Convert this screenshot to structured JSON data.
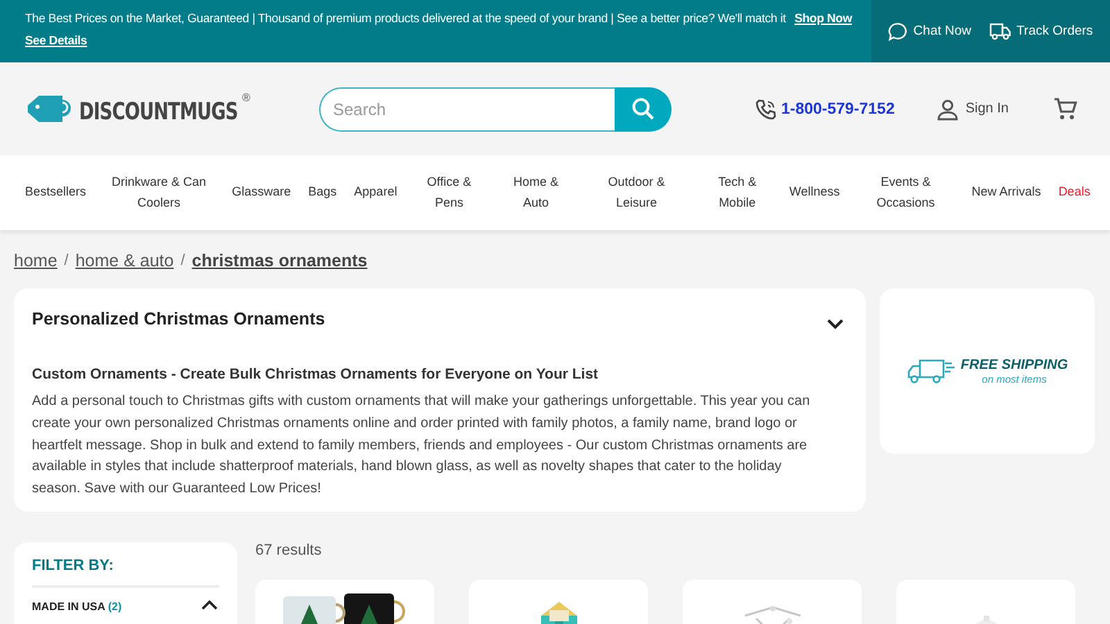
{
  "promo_bar": {
    "message": "The Best Prices on the Market, Guaranteed | Thousand of premium products delivered at the speed of your brand | See a better price? We'll match it",
    "links": [
      "Shop Now",
      "See Details"
    ],
    "actions": [
      {
        "kind": "chat",
        "label": "Chat Now"
      },
      {
        "kind": "track",
        "label": "Track Orders"
      }
    ]
  },
  "header": {
    "logo": {
      "name": "DISCOUNTMUGS",
      "mark": "®"
    },
    "search": {
      "placeholder": "Search"
    },
    "phone": "1-800-579-7152",
    "sign_in": "Sign In"
  },
  "nav": [
    {
      "label": "Bestsellers",
      "highlight": false
    },
    {
      "label": "Drinkware & Can Coolers",
      "highlight": false
    },
    {
      "label": "Glassware",
      "highlight": false
    },
    {
      "label": "Bags",
      "highlight": false
    },
    {
      "label": "Apparel",
      "highlight": false
    },
    {
      "label": "Office & Pens",
      "highlight": false
    },
    {
      "label": "Home & Auto",
      "highlight": false
    },
    {
      "label": "Outdoor & Leisure",
      "highlight": false
    },
    {
      "label": "Tech & Mobile",
      "highlight": false
    },
    {
      "label": "Wellness",
      "highlight": false
    },
    {
      "label": "Events & Occasions",
      "highlight": false
    },
    {
      "label": "New Arrivals",
      "highlight": false
    },
    {
      "label": "Deals",
      "highlight": true
    }
  ],
  "breadcrumb": {
    "items": [
      {
        "label": "home",
        "current": false
      },
      {
        "label": "home & auto",
        "current": false
      },
      {
        "label": "christmas ornaments",
        "current": true
      }
    ],
    "separators": [
      "/",
      "/"
    ]
  },
  "category": {
    "title": "Personalized Christmas Ornaments",
    "expanded": true,
    "subtitle": "Custom Ornaments - Create Bulk Christmas Ornaments for Everyone on Your List",
    "description": "Add a personal touch to Christmas gifts with custom ornaments that will make your gatherings unforgettable. This year you can create your own personalized Christmas ornaments online and order printed with family photos, a family name, brand logo or heartfelt message. Shop in bulk and extend to family members, friends and employees - Our custom Christmas ornaments are available in styles that include shatterproof materials, hand blown glass, as well as novelty shapes that cater to the holiday season. Save with our Guaranteed Low Prices!"
  },
  "shipping_banner": {
    "title": "FREE SHIPPING",
    "subtitle": "on most items"
  },
  "filter": {
    "title": "FILTER BY:",
    "groups": [
      {
        "label": "MADE IN USA",
        "count": "(2)",
        "expanded": true
      }
    ]
  },
  "results": {
    "count": "67 results"
  }
}
